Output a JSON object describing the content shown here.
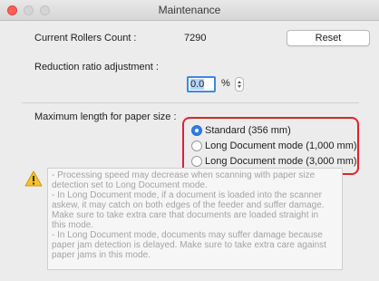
{
  "window": {
    "title": "Maintenance"
  },
  "rollers": {
    "label": "Current Rollers Count :",
    "value": "7290",
    "reset_label": "Reset"
  },
  "reduction": {
    "label": "Reduction ratio adjustment :",
    "value": "0.0",
    "unit": "%"
  },
  "paper": {
    "label": "Maximum length for paper size :",
    "options": [
      {
        "label": "Standard (356 mm)",
        "selected": true
      },
      {
        "label": "Long Document mode (1,000 mm)",
        "selected": false
      },
      {
        "label": "Long Document mode (3,000 mm)",
        "selected": false
      }
    ]
  },
  "warning": {
    "icon": "warning-icon",
    "lines": [
      "- Processing speed may decrease when scanning with paper size",
      "detection set to Long Document mode.",
      "- In Long Document mode, if a document is loaded into the scanner",
      "askew, it may catch on both edges of the feeder and suffer damage.",
      "Make sure to take extra care that documents are loaded straight in",
      "this mode.",
      "- In Long Document mode, documents may suffer damage because",
      "paper jam detection is delayed. Make sure to take extra care against",
      "paper jams in this mode."
    ]
  },
  "colors": {
    "highlight": "#d9252c",
    "accent": "#2f7de2"
  }
}
